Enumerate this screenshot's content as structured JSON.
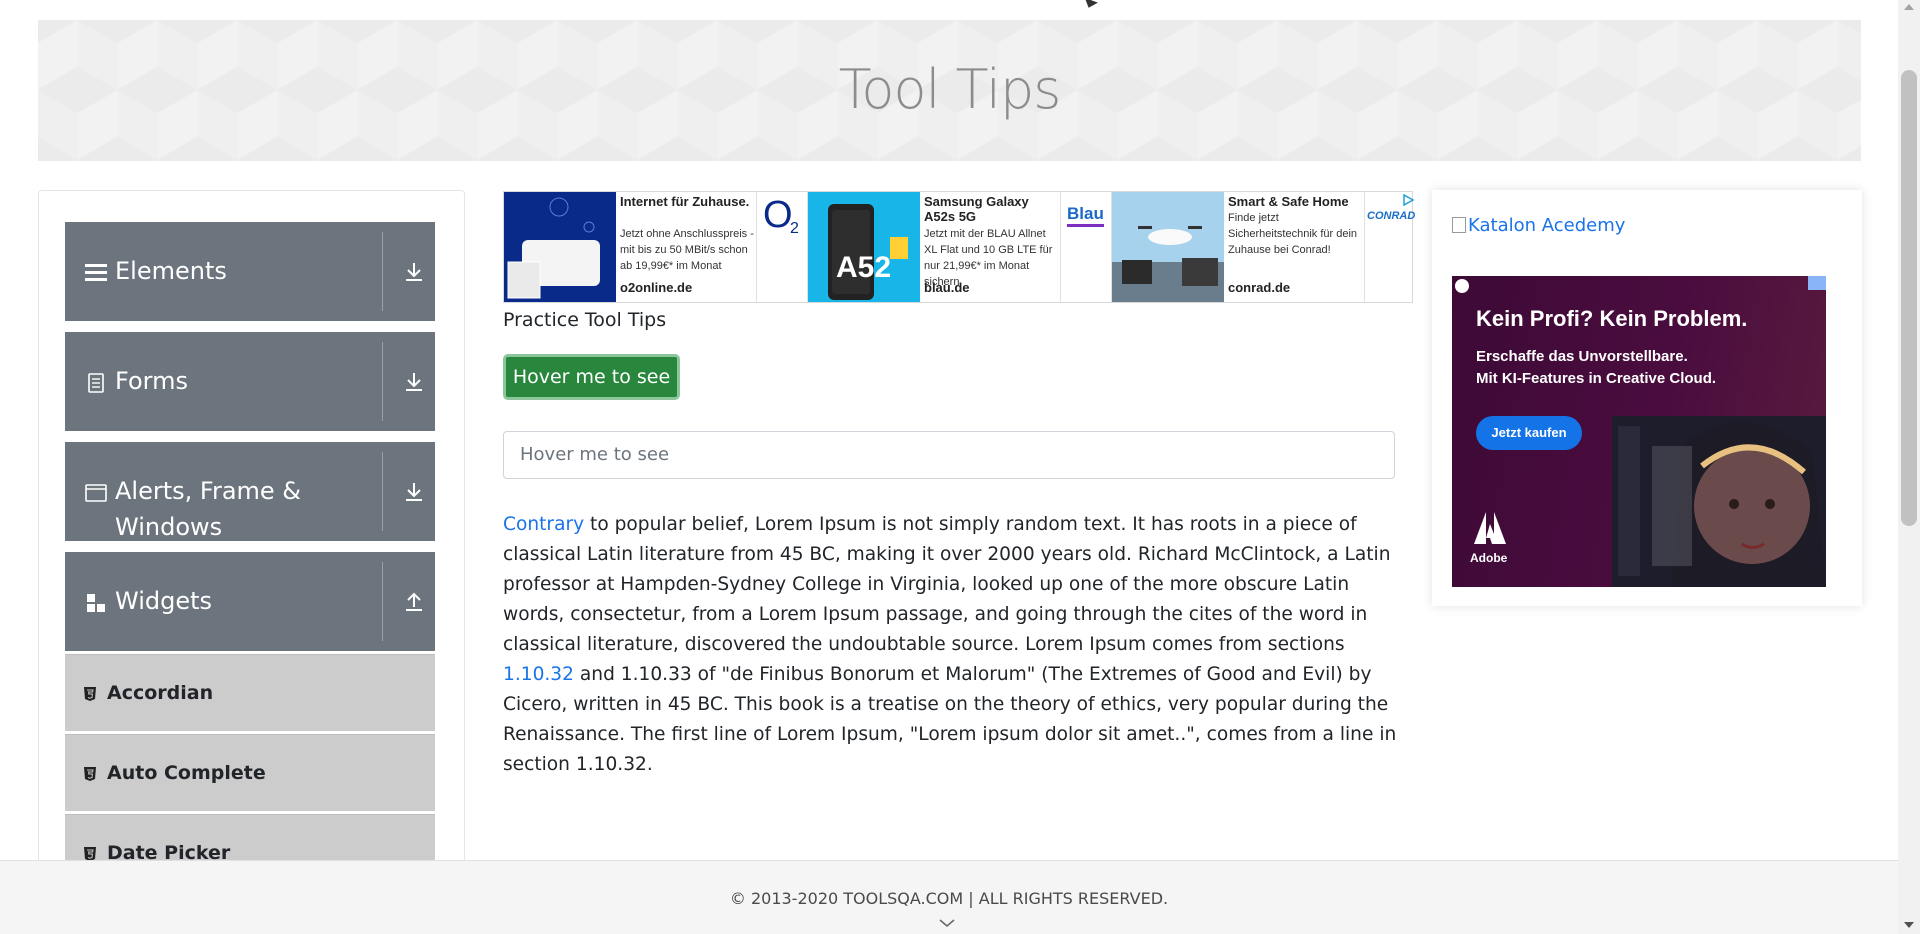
{
  "banner": {
    "title": "Tool Tips"
  },
  "sidebar": {
    "groups": [
      {
        "label": "Elements",
        "icon": "hamburger-icon",
        "arrow": "download-icon"
      },
      {
        "label": "Forms",
        "icon": "document-icon",
        "arrow": "download-icon"
      },
      {
        "label": "Alerts, Frame &",
        "label2": "Windows",
        "icon": "window-icon",
        "arrow": "download-icon"
      },
      {
        "label": "Widgets",
        "icon": "widgets-icon",
        "arrow": "upload-icon"
      }
    ],
    "items": [
      {
        "label": "Accordian"
      },
      {
        "label": "Auto Complete"
      },
      {
        "label": "Date Picker"
      }
    ]
  },
  "ads": [
    {
      "head": "Internet für Zuhause.",
      "body": "Jetzt ohne Anschlusspreis - mit bis zu 50 MBit/s schon ab 19,99€* im Monat",
      "domain": "o2online.de",
      "logo": "O2",
      "logo_sub": "2"
    },
    {
      "head": "Samsung Galaxy A52s 5G",
      "body": "Jetzt mit der BLAU Allnet XL Flat und 10 GB LTE für nur 21,99€* im Monat sichern",
      "domain": "blau.de",
      "logo": "Blau"
    },
    {
      "head": "Smart & Safe Home",
      "body": "Finde jetzt Sicherheitstechnik für dein Zuhause bei Conrad!",
      "domain": "conrad.de",
      "logo": "CONRAD"
    }
  ],
  "main": {
    "practice_label": "Practice Tool Tips",
    "hover_button": "Hover me to see",
    "hover_input_placeholder": "Hover me to see",
    "paragraph": {
      "link1": "Contrary",
      "text1": " to popular belief, Lorem Ipsum is not simply random text. It has roots in a piece of classical Latin literature from 45 BC, making it over 2000 years old. Richard McClintock, a Latin professor at Hampden-Sydney College in Virginia, looked up one of the more obscure Latin words, consectetur, from a Lorem Ipsum passage, and going through the cites of the word in classical literature, discovered the undoubtable source. Lorem Ipsum comes from sections ",
      "link2": "1.10.32",
      "text2": " and 1.10.33 of \"de Finibus Bonorum et Malorum\" (The Extremes of Good and Evil) by Cicero, written in 45 BC. This book is a treatise on the theory of ethics, very popular during the Renaissance. The first line of Lorem Ipsum, \"Lorem ipsum dolor sit amet..\", comes from a line in section 1.10.32."
    }
  },
  "right_ad": {
    "katalon_alt": "Katalon Acedemy",
    "title": "Kein Profi? Kein Problem.",
    "sub1": "Erschaffe das Unvorstellbare.",
    "sub2": "Mit KI-Features in Creative Cloud.",
    "button": "Jetzt kaufen",
    "brand": "Adobe"
  },
  "footer": {
    "text": "© 2013-2020 TOOLSQA.COM | ALL RIGHTS RESERVED."
  },
  "colors": {
    "sidebar_group": "#6c757d",
    "sidebar_item": "#cccccc",
    "button_green": "#28873c",
    "link": "#1a73e8"
  }
}
